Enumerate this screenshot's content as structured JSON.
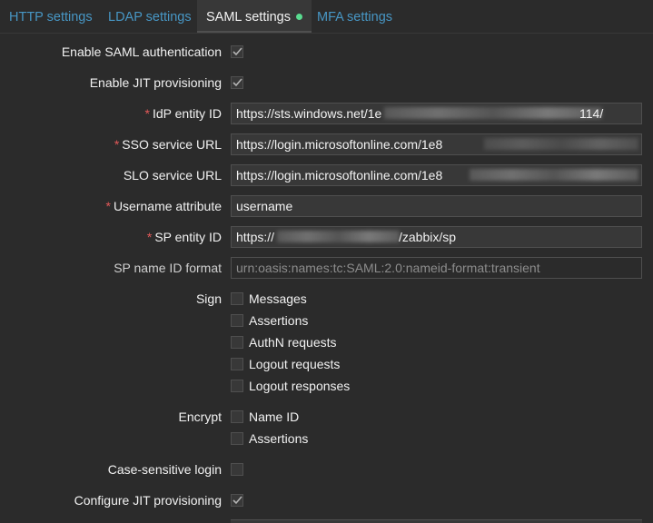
{
  "tabs": [
    {
      "label": "HTTP settings"
    },
    {
      "label": "LDAP settings"
    },
    {
      "label": "SAML settings",
      "active": true
    },
    {
      "label": "MFA settings"
    }
  ],
  "form": {
    "enable_saml": {
      "label": "Enable SAML authentication",
      "checked": true
    },
    "enable_jit": {
      "label": "Enable JIT provisioning",
      "checked": true
    },
    "idp_entity_id": {
      "label": "IdP entity ID",
      "required": true,
      "value_start": "https://sts.windows.net/1e",
      "value_end": "114/"
    },
    "sso_service_url": {
      "label": "SSO service URL",
      "required": true,
      "value": "https://login.microsoftonline.com/1e8"
    },
    "slo_service_url": {
      "label": "SLO service URL",
      "required": false,
      "value": "https://login.microsoftonline.com/1e8"
    },
    "username_attribute": {
      "label": "Username attribute",
      "required": true,
      "value": "username"
    },
    "sp_entity_id": {
      "label": "SP entity ID",
      "required": true,
      "value_start": "https://",
      "value_end": "/zabbix/sp"
    },
    "sp_name_id_format": {
      "label": "SP name ID format",
      "placeholder": "urn:oasis:names:tc:SAML:2.0:nameid-format:transient"
    },
    "sign": {
      "label": "Sign",
      "options": [
        {
          "label": "Messages",
          "checked": false
        },
        {
          "label": "Assertions",
          "checked": false
        },
        {
          "label": "AuthN requests",
          "checked": false
        },
        {
          "label": "Logout requests",
          "checked": false
        },
        {
          "label": "Logout responses",
          "checked": false
        }
      ]
    },
    "encrypt": {
      "label": "Encrypt",
      "options": [
        {
          "label": "Name ID",
          "checked": false
        },
        {
          "label": "Assertions",
          "checked": false
        }
      ]
    },
    "case_sensitive_login": {
      "label": "Case-sensitive login",
      "checked": false
    },
    "configure_jit": {
      "label": "Configure JIT provisioning",
      "checked": true
    }
  },
  "colors": {
    "background": "#2b2b2b",
    "field_bg": "#383838",
    "border": "#4f4f4f",
    "link": "#4796c4",
    "required": "#e45959",
    "status_dot": "#59db8f",
    "check": "#b3b3b3"
  }
}
